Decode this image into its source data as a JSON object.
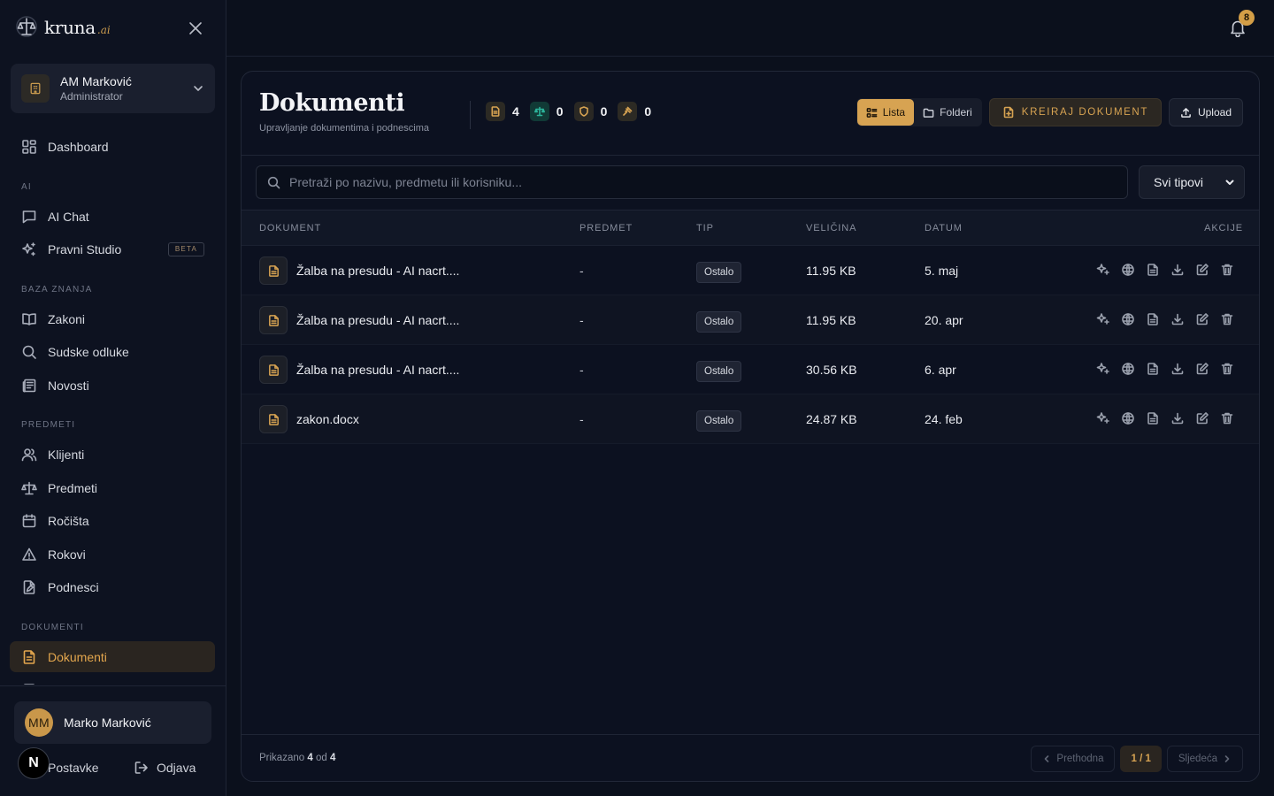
{
  "brand": {
    "name": "kruna",
    "suffix": ".ai"
  },
  "account": {
    "name": "AM Marković",
    "role": "Administrator"
  },
  "nav": {
    "dashboard": "Dashboard",
    "section_ai": "AI",
    "ai_chat": "AI Chat",
    "pravni_studio": "Pravni Studio",
    "beta": "BETA",
    "section_knowledge": "BAZA ZNANJA",
    "zakoni": "Zakoni",
    "sudske_odluke": "Sudske odluke",
    "novosti": "Novosti",
    "section_cases": "PREDMETI",
    "klijenti": "Klijenti",
    "predmeti": "Predmeti",
    "rocista": "Ročišta",
    "rokovi": "Rokovi",
    "podnesci": "Podnesci",
    "section_docs": "DOKUMENTI",
    "dokumenti": "Dokumenti"
  },
  "footer": {
    "user_initials": "MM",
    "user_name": "Marko Marković",
    "settings": "Postavke",
    "logout": "Odjava",
    "badge": "N"
  },
  "topbar": {
    "notifications": "8"
  },
  "page": {
    "title": "Dokumenti",
    "subtitle": "Upravljanje dokumentima i podnescima",
    "stats": [
      {
        "icon": "document-icon",
        "value": "4",
        "color": "#d7a352"
      },
      {
        "icon": "scale-icon",
        "value": "0",
        "color": "#2bb39a"
      },
      {
        "icon": "shield-icon",
        "value": "0",
        "color": "#d7a352"
      },
      {
        "icon": "gavel-icon",
        "value": "0",
        "color": "#d7a352"
      }
    ],
    "view_list": "Lista",
    "view_folders": "Folderi",
    "create": "KREIRAJ DOKUMENT",
    "upload": "Upload"
  },
  "filters": {
    "search_placeholder": "Pretraži po nazivu, predmetu ili korisniku...",
    "type": "Svi tipovi"
  },
  "table": {
    "headers": {
      "document": "DOKUMENT",
      "case": "PREDMET",
      "type": "TIP",
      "size": "VELIČINA",
      "date": "DATUM",
      "actions": "AKCIJE"
    },
    "rows": [
      {
        "name": "Žalba na presudu - AI nacrt....",
        "case": "-",
        "type": "Ostalo",
        "size": "11.95 KB",
        "date": "5. maj"
      },
      {
        "name": "Žalba na presudu - AI nacrt....",
        "case": "-",
        "type": "Ostalo",
        "size": "11.95 KB",
        "date": "20. apr"
      },
      {
        "name": "Žalba na presudu - AI nacrt....",
        "case": "-",
        "type": "Ostalo",
        "size": "30.56 KB",
        "date": "6. apr"
      },
      {
        "name": "zakon.docx",
        "case": "-",
        "type": "Ostalo",
        "size": "24.87 KB",
        "date": "24. feb"
      }
    ]
  },
  "pagination": {
    "shown_label": "Prikazano",
    "shown": "4",
    "of_label": "od",
    "total": "4",
    "prev": "Prethodna",
    "current": "1 / 1",
    "next": "Sljedeća"
  },
  "colors": {
    "accent": "#d7a352",
    "background": "#0b101c",
    "teal": "#2bb39a"
  }
}
